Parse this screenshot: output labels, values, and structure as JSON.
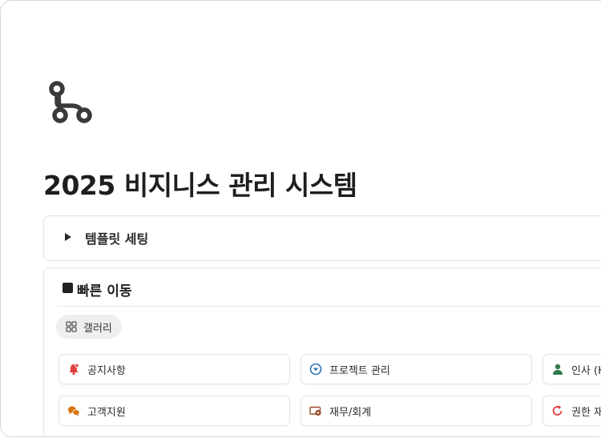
{
  "page": {
    "title": "2025 비지니스 관리 시스템",
    "icon": "workflow-branch-icon"
  },
  "toggle": {
    "label": "템플릿 세팅"
  },
  "quick_nav": {
    "title": "빠른 이동",
    "view_tab": {
      "label": "갤러리",
      "icon": "gallery-grid-icon"
    },
    "cards": [
      {
        "label": "공지사항",
        "icon": "bell-icon",
        "color": "#e03e3e"
      },
      {
        "label": "프로젝트 관리",
        "icon": "target-icon",
        "color": "#2f6fb5"
      },
      {
        "label": "인사 (H",
        "icon": "person-icon",
        "color": "#2f7a4e"
      },
      {
        "label": "고객지원",
        "icon": "chat-bubbles-icon",
        "color": "#d9730d"
      },
      {
        "label": "재무/회계",
        "icon": "money-icon",
        "color": "#9a4b2b"
      },
      {
        "label": "권한 재",
        "icon": "refresh-icon",
        "color": "#e03e3e"
      }
    ]
  }
}
